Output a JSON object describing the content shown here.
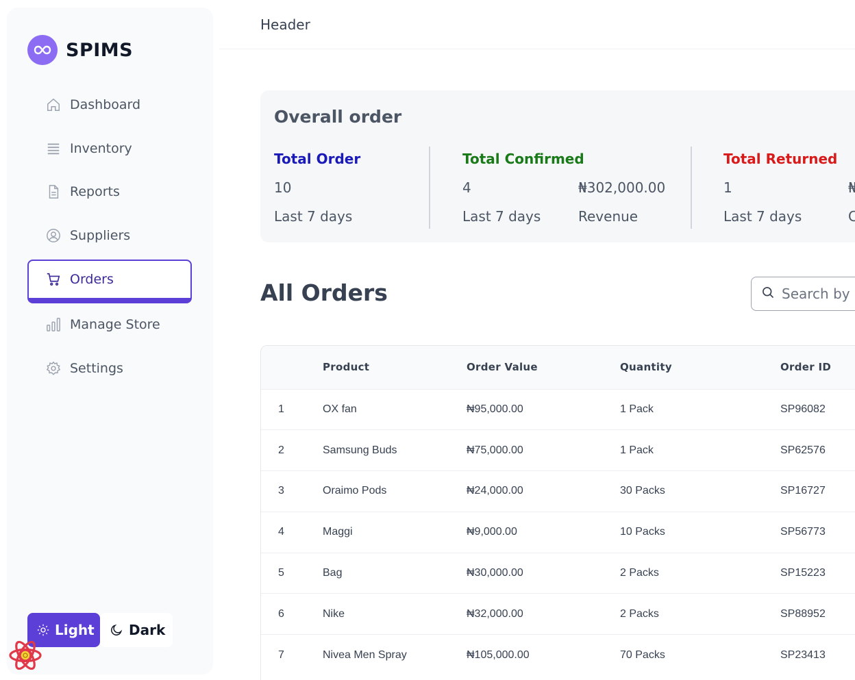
{
  "brand": {
    "name": "SPIMS",
    "accent": "#5b3fd6"
  },
  "sidebar": {
    "items": [
      {
        "label": "Dashboard",
        "icon": "home-icon"
      },
      {
        "label": "Inventory",
        "icon": "inventory-icon"
      },
      {
        "label": "Reports",
        "icon": "document-icon"
      },
      {
        "label": "Suppliers",
        "icon": "user-circle-icon"
      },
      {
        "label": "Orders",
        "icon": "cart-icon",
        "active": true
      },
      {
        "label": "Manage Store",
        "icon": "bar-chart-icon"
      },
      {
        "label": "Settings",
        "icon": "gear-icon"
      }
    ],
    "theme": {
      "light_label": "Light",
      "dark_label": "Dark",
      "selected": "Light"
    }
  },
  "header": {
    "title": "Header"
  },
  "overview": {
    "title": "Overall order",
    "total_order": {
      "label": "Total Order",
      "value": "10",
      "period": "Last 7 days",
      "color": "#1a1ab8"
    },
    "total_confirmed": {
      "label": "Total Confirmed",
      "value": "4",
      "period": "Last 7 days",
      "amount": "₦302,000.00",
      "amount_label": "Revenue",
      "color": "#1a7a1a"
    },
    "total_returned": {
      "label": "Total Returned",
      "value": "1",
      "period": "Last 7 days",
      "amount_partial": "₦",
      "amount_label_partial": "C",
      "color": "#d91a1a"
    }
  },
  "orders": {
    "title": "All Orders",
    "search_placeholder": "Search by",
    "columns": [
      "",
      "Product",
      "Order Value",
      "Quantity",
      "Order ID"
    ],
    "rows": [
      {
        "no": "1",
        "product": "OX fan",
        "value": "₦95,000.00",
        "qty": "1 Pack",
        "id": "SP96082"
      },
      {
        "no": "2",
        "product": "Samsung Buds",
        "value": "₦75,000.00",
        "qty": "1 Pack",
        "id": "SP62576"
      },
      {
        "no": "3",
        "product": "Oraimo Pods",
        "value": "₦24,000.00",
        "qty": "30 Packs",
        "id": "SP16727"
      },
      {
        "no": "4",
        "product": "Maggi",
        "value": "₦9,000.00",
        "qty": "10 Packs",
        "id": "SP56773"
      },
      {
        "no": "5",
        "product": "Bag",
        "value": "₦30,000.00",
        "qty": "2 Packs",
        "id": "SP15223"
      },
      {
        "no": "6",
        "product": "Nike",
        "value": "₦32,000.00",
        "qty": "2 Packs",
        "id": "SP88952"
      },
      {
        "no": "7",
        "product": "Nivea Men Spray",
        "value": "₦105,000.00",
        "qty": "70 Packs",
        "id": "SP23413"
      }
    ]
  }
}
